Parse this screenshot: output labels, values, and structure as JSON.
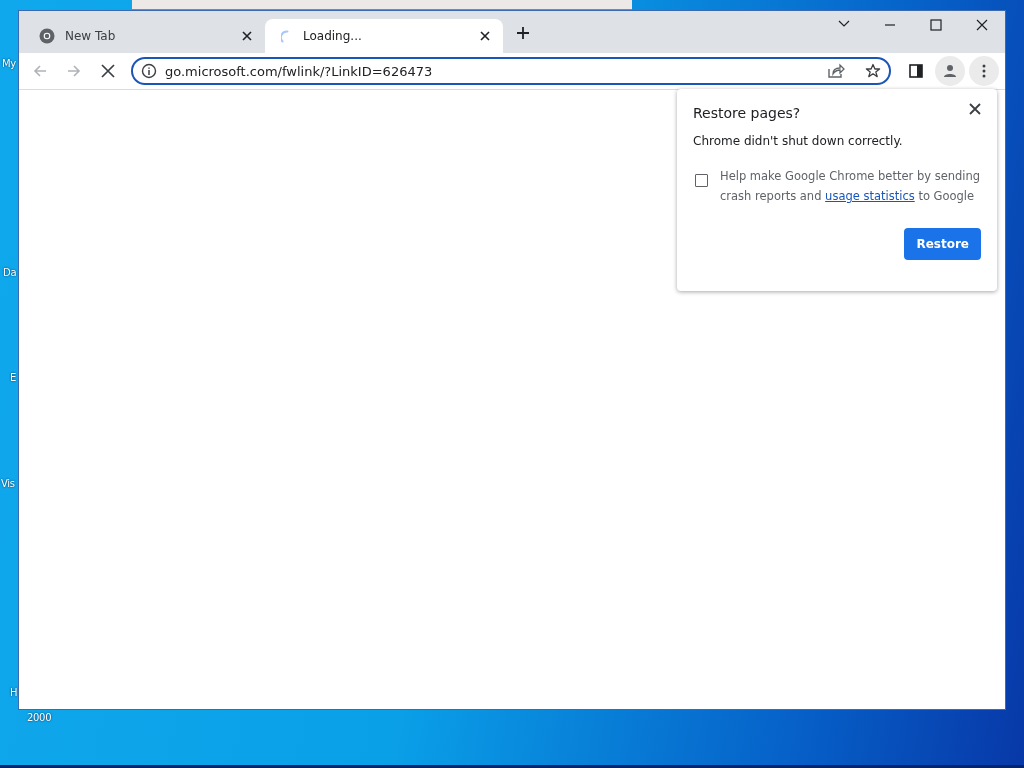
{
  "desktop_icons": [
    {
      "label": "My"
    },
    {
      "label": "Da"
    },
    {
      "label": "E"
    },
    {
      "label": "Vis"
    },
    {
      "label": "H"
    },
    {
      "label": "2000"
    }
  ],
  "tabs": [
    {
      "title": "New Tab",
      "selected": false,
      "kind": "page"
    },
    {
      "title": "Loading...",
      "selected": true,
      "kind": "loading"
    }
  ],
  "address_bar": {
    "value": "go.microsoft.com/fwlink/?LinkID=626473",
    "focused": true
  },
  "dialog": {
    "title": "Restore pages?",
    "message": "Chrome didn't shut down correctly.",
    "checkbox": {
      "label": "Help make Google Chrome better by sending crash reports and",
      "link": "usage statistics",
      "suffix": "to Google",
      "checked": false
    },
    "button": "Restore"
  }
}
